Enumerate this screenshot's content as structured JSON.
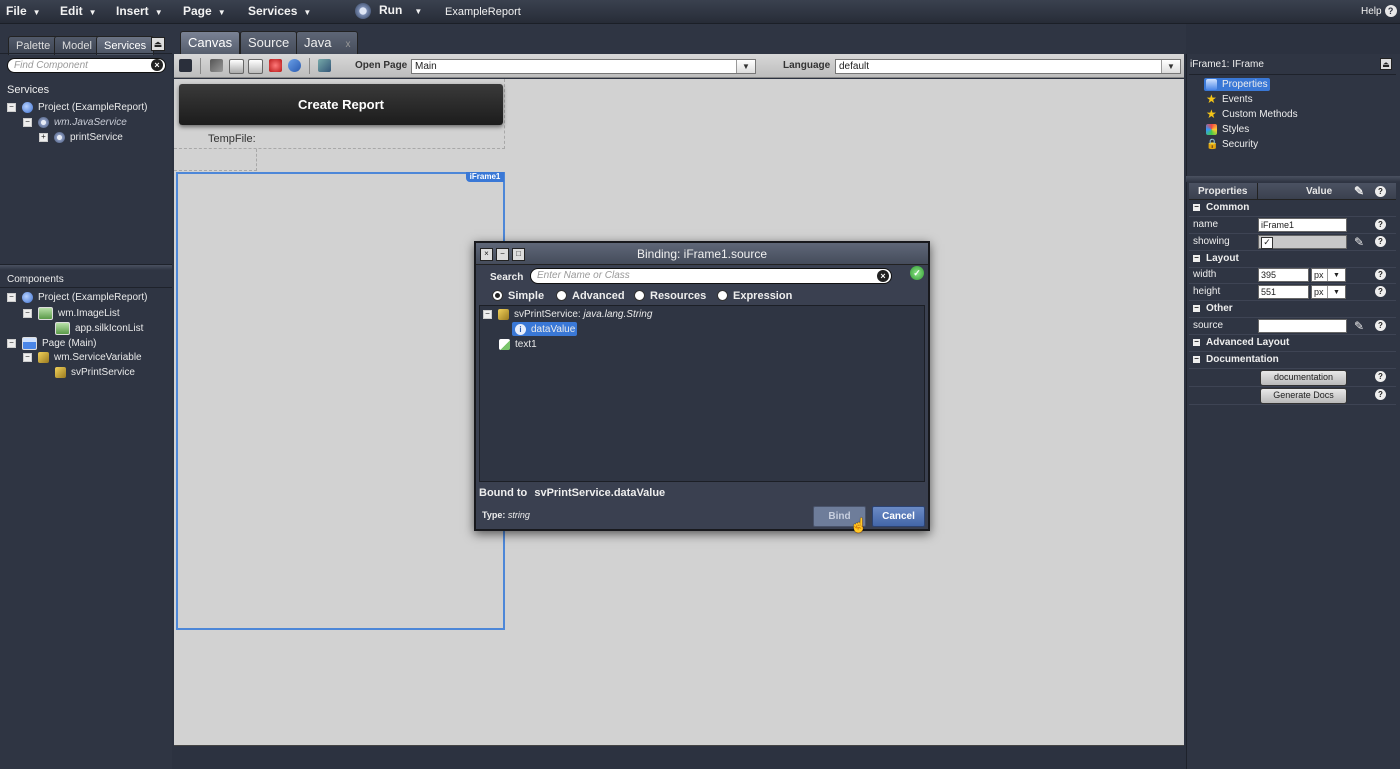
{
  "menubar": {
    "items": [
      "File",
      "Edit",
      "Insert",
      "Page",
      "Services"
    ],
    "run_label": "Run",
    "project_name": "ExampleReport",
    "help_label": "Help"
  },
  "left_panel": {
    "tabs": [
      "Palette",
      "Model",
      "Services"
    ],
    "active_tab": "Services",
    "search_placeholder": "Find Component",
    "services_title": "Services",
    "services_tree": [
      {
        "label": "Project (ExampleReport)",
        "icon": "project-icon"
      },
      {
        "label": "wm.JavaService",
        "icon": "gear-icon"
      },
      {
        "label": "printService",
        "icon": "gear-icon"
      }
    ],
    "components_title": "Components",
    "components_tree": [
      {
        "label": "Project (ExampleReport)",
        "icon": "project-icon"
      },
      {
        "label": "wm.ImageList",
        "icon": "image-list-icon"
      },
      {
        "label": "app.silkIconList",
        "icon": "image-icon"
      },
      {
        "label": "Page (Main)",
        "icon": "page-icon"
      },
      {
        "label": "wm.ServiceVariable",
        "icon": "service-variable-icon"
      },
      {
        "label": "svPrintService",
        "icon": "service-variable-icon"
      }
    ]
  },
  "editor_tabs": [
    "Canvas",
    "Source",
    "Java"
  ],
  "editor_tab_close": "x",
  "toolbar": {
    "open_page_label": "Open Page",
    "open_page_value": "Main",
    "language_label": "Language",
    "language_value": "default"
  },
  "canvas": {
    "create_report_label": "Create Report",
    "temp_file_label": "TempFile:",
    "iframe_badge": "iFrame1"
  },
  "dialog": {
    "title": "Binding: iFrame1.source",
    "search_label": "Search",
    "search_placeholder": "Enter Name or Class",
    "modes": [
      "Simple",
      "Advanced",
      "Resources",
      "Expression"
    ],
    "selected_mode": "Simple",
    "tree": [
      {
        "label": "svPrintService:",
        "type": "java.lang.String"
      },
      {
        "label": "dataValue"
      },
      {
        "label": "text1"
      }
    ],
    "bound_to_label": "Bound to",
    "bound_to_value": "svPrintService.dataValue",
    "type_label": "Type:",
    "type_value": "string",
    "bind_label": "Bind",
    "cancel_label": "Cancel"
  },
  "right_panel": {
    "header": "iFrame1: IFrame",
    "nav": [
      "Properties",
      "Events",
      "Custom Methods",
      "Styles",
      "Security"
    ],
    "active_nav": "Properties",
    "grid_headers": [
      "Properties",
      "Value"
    ],
    "groups": {
      "common": "Common",
      "layout": "Layout",
      "other": "Other",
      "advanced_layout": "Advanced Layout",
      "documentation": "Documentation"
    },
    "props": {
      "name_label": "name",
      "name_value": "iFrame1",
      "showing_label": "showing",
      "showing_value": "✓",
      "width_label": "width",
      "width_value": "395",
      "width_unit": "px",
      "height_label": "height",
      "height_value": "551",
      "height_unit": "px",
      "source_label": "source",
      "source_value": ""
    },
    "doc_button": "documentation",
    "gen_docs_button": "Generate Docs"
  },
  "colors": {
    "accent": "#3a78d6",
    "dark_bg": "#2c3240",
    "canvas_bg": "#d2d2d2",
    "ok_green": "#4caf50"
  }
}
